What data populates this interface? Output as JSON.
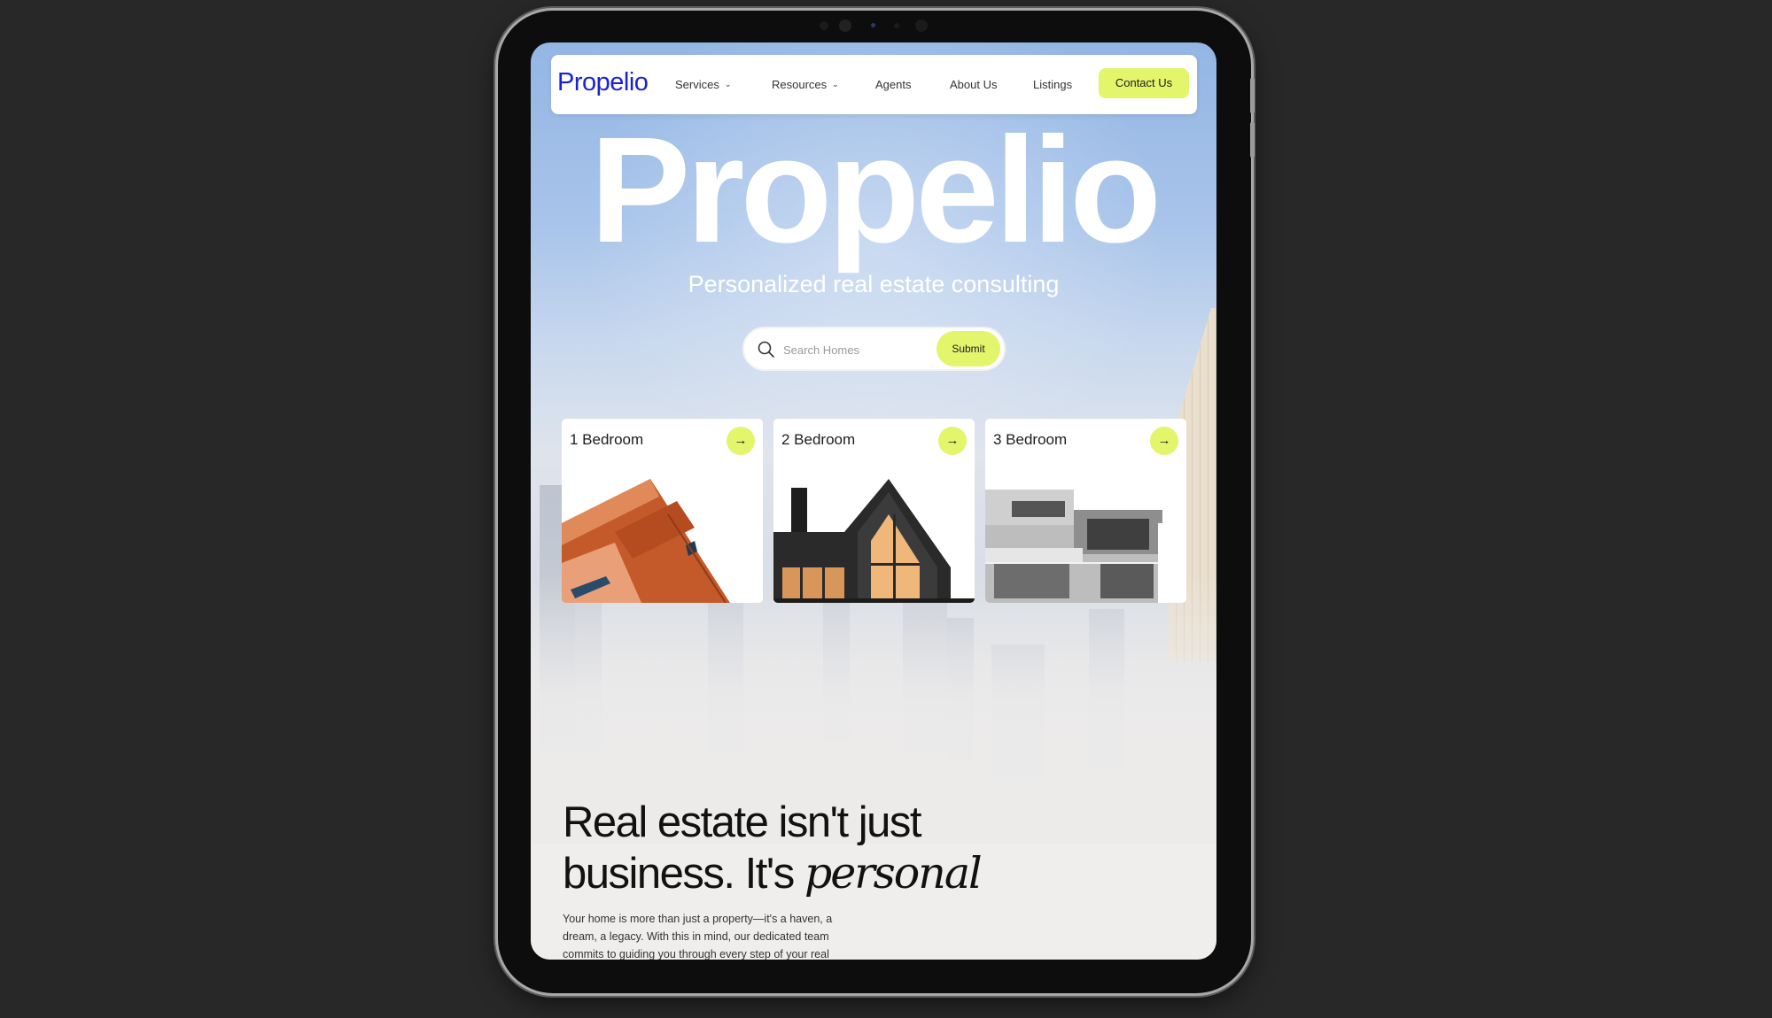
{
  "nav": {
    "logo": "Propelio",
    "items": [
      {
        "label": "Services",
        "has_dropdown": true
      },
      {
        "label": "Resources",
        "has_dropdown": true
      },
      {
        "label": "Agents",
        "has_dropdown": false
      },
      {
        "label": "About Us",
        "has_dropdown": false
      },
      {
        "label": "Listings",
        "has_dropdown": false
      }
    ],
    "contact_label": "Contact Us"
  },
  "hero": {
    "title": "Propelio",
    "subtitle": "Personalized real estate consulting"
  },
  "search": {
    "placeholder": "Search Homes",
    "submit_label": "Submit"
  },
  "cards": [
    {
      "label": "1 Bedroom",
      "arrow": "→"
    },
    {
      "label": "2 Bedroom",
      "arrow": "→"
    },
    {
      "label": "3 Bedroom",
      "arrow": "→"
    }
  ],
  "section": {
    "heading_line1": "Real estate isn't just",
    "heading_line2": "business. It's ",
    "heading_emphasis": "personal",
    "paragraph": "Your home is more than just a property—it's a haven, a dream, a legacy. With this in mind, our dedicated team commits to guiding you through every step of your real"
  },
  "colors": {
    "accent": "#e3f56b",
    "logo": "#1a22d6",
    "background": "#282828"
  }
}
